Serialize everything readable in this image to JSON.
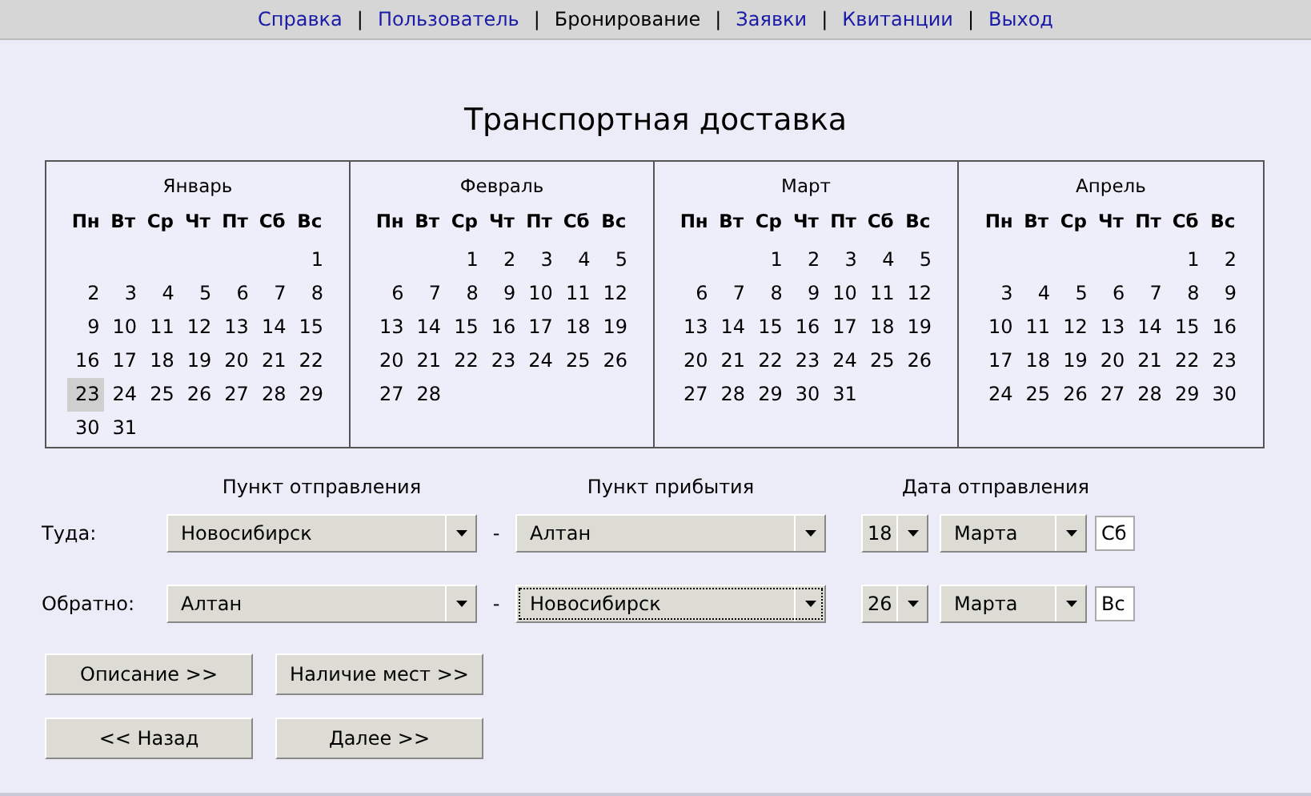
{
  "nav": {
    "items": [
      {
        "label": "Справка",
        "selected": false
      },
      {
        "label": "Пользователь",
        "selected": false
      },
      {
        "label": "Бронирование",
        "selected": true
      },
      {
        "label": "Заявки",
        "selected": false
      },
      {
        "label": "Квитанции",
        "selected": false
      },
      {
        "label": "Выход",
        "selected": false
      }
    ],
    "separators": [
      "|",
      "|",
      "|",
      "|",
      "|"
    ]
  },
  "title": "Транспортная доставка",
  "calendar": [
    {
      "month": "Январь",
      "weekdays": [
        "Пн",
        "Вт",
        "Ср",
        "Чт",
        "Пт",
        "Сб",
        "Вс"
      ],
      "weeks": [
        {
          "days": [
            {
              "day": "1",
              "selected": false
            }
          ]
        },
        {
          "days": [
            {
              "day": "2",
              "selected": false
            },
            {
              "day": "3",
              "selected": false
            },
            {
              "day": "4",
              "selected": false
            },
            {
              "day": "5",
              "selected": false
            },
            {
              "day": "6",
              "selected": false
            },
            {
              "day": "7",
              "selected": false
            },
            {
              "day": "8",
              "selected": false
            }
          ]
        },
        {
          "days": [
            {
              "day": "9",
              "selected": false
            },
            {
              "day": "10",
              "selected": false
            },
            {
              "day": "11",
              "selected": false
            },
            {
              "day": "12",
              "selected": false
            },
            {
              "day": "13",
              "selected": false
            },
            {
              "day": "14",
              "selected": false
            },
            {
              "day": "15",
              "selected": false
            }
          ]
        },
        {
          "days": [
            {
              "day": "16",
              "selected": false
            },
            {
              "day": "17",
              "selected": false
            },
            {
              "day": "18",
              "selected": false
            },
            {
              "day": "19",
              "selected": false
            },
            {
              "day": "20",
              "selected": false
            },
            {
              "day": "21",
              "selected": false
            },
            {
              "day": "22",
              "selected": false
            }
          ]
        },
        {
          "days": [
            {
              "day": "23",
              "selected": true
            },
            {
              "day": "24",
              "selected": false
            },
            {
              "day": "25",
              "selected": false
            },
            {
              "day": "26",
              "selected": false
            },
            {
              "day": "27",
              "selected": false
            },
            {
              "day": "28",
              "selected": false
            },
            {
              "day": "29",
              "selected": false
            }
          ]
        },
        {
          "days": [
            {
              "day": "30",
              "selected": false
            },
            {
              "day": "31",
              "selected": false
            }
          ]
        }
      ]
    },
    {
      "month": "Февраль",
      "weekdays": [
        "Пн",
        "Вт",
        "Ср",
        "Чт",
        "Пт",
        "Сб",
        "Вс"
      ],
      "weeks": [
        {
          "days": [
            {
              "day": "1",
              "selected": false
            },
            {
              "day": "2",
              "selected": false
            },
            {
              "day": "3",
              "selected": false
            },
            {
              "day": "4",
              "selected": false
            },
            {
              "day": "5",
              "selected": false
            }
          ]
        },
        {
          "days": [
            {
              "day": "6",
              "selected": false
            },
            {
              "day": "7",
              "selected": false
            },
            {
              "day": "8",
              "selected": false
            },
            {
              "day": "9",
              "selected": false
            },
            {
              "day": "10",
              "selected": false
            },
            {
              "day": "11",
              "selected": false
            },
            {
              "day": "12",
              "selected": false
            }
          ]
        },
        {
          "days": [
            {
              "day": "13",
              "selected": false
            },
            {
              "day": "14",
              "selected": false
            },
            {
              "day": "15",
              "selected": false
            },
            {
              "day": "16",
              "selected": false
            },
            {
              "day": "17",
              "selected": false
            },
            {
              "day": "18",
              "selected": false
            },
            {
              "day": "19",
              "selected": false
            }
          ]
        },
        {
          "days": [
            {
              "day": "20",
              "selected": false
            },
            {
              "day": "21",
              "selected": false
            },
            {
              "day": "22",
              "selected": false
            },
            {
              "day": "23",
              "selected": false
            },
            {
              "day": "24",
              "selected": false
            },
            {
              "day": "25",
              "selected": false
            },
            {
              "day": "26",
              "selected": false
            }
          ]
        },
        {
          "days": [
            {
              "day": "27",
              "selected": false
            },
            {
              "day": "28",
              "selected": false
            }
          ]
        }
      ]
    },
    {
      "month": "Март",
      "weekdays": [
        "Пн",
        "Вт",
        "Ср",
        "Чт",
        "Пт",
        "Сб",
        "Вс"
      ],
      "weeks": [
        {
          "days": [
            {
              "day": "1",
              "selected": false
            },
            {
              "day": "2",
              "selected": false
            },
            {
              "day": "3",
              "selected": false
            },
            {
              "day": "4",
              "selected": false
            },
            {
              "day": "5",
              "selected": false
            }
          ]
        },
        {
          "days": [
            {
              "day": "6",
              "selected": false
            },
            {
              "day": "7",
              "selected": false
            },
            {
              "day": "8",
              "selected": false
            },
            {
              "day": "9",
              "selected": false
            },
            {
              "day": "10",
              "selected": false
            },
            {
              "day": "11",
              "selected": false
            },
            {
              "day": "12",
              "selected": false
            }
          ]
        },
        {
          "days": [
            {
              "day": "13",
              "selected": false
            },
            {
              "day": "14",
              "selected": false
            },
            {
              "day": "15",
              "selected": false
            },
            {
              "day": "16",
              "selected": false
            },
            {
              "day": "17",
              "selected": false
            },
            {
              "day": "18",
              "selected": false
            },
            {
              "day": "19",
              "selected": false
            }
          ]
        },
        {
          "days": [
            {
              "day": "20",
              "selected": false
            },
            {
              "day": "21",
              "selected": false
            },
            {
              "day": "22",
              "selected": false
            },
            {
              "day": "23",
              "selected": false
            },
            {
              "day": "24",
              "selected": false
            },
            {
              "day": "25",
              "selected": false
            },
            {
              "day": "26",
              "selected": false
            }
          ]
        },
        {
          "days": [
            {
              "day": "27",
              "selected": false
            },
            {
              "day": "28",
              "selected": false
            },
            {
              "day": "29",
              "selected": false
            },
            {
              "day": "30",
              "selected": false
            },
            {
              "day": "31",
              "selected": false
            }
          ]
        }
      ]
    },
    {
      "month": "Апрель",
      "weekdays": [
        "Пн",
        "Вт",
        "Ср",
        "Чт",
        "Пт",
        "Сб",
        "Вс"
      ],
      "weeks": [
        {
          "days": [
            {
              "day": "1",
              "selected": false
            },
            {
              "day": "2",
              "selected": false
            }
          ]
        },
        {
          "days": [
            {
              "day": "3",
              "selected": false
            },
            {
              "day": "4",
              "selected": false
            },
            {
              "day": "5",
              "selected": false
            },
            {
              "day": "6",
              "selected": false
            },
            {
              "day": "7",
              "selected": false
            },
            {
              "day": "8",
              "selected": false
            },
            {
              "day": "9",
              "selected": false
            }
          ]
        },
        {
          "days": [
            {
              "day": "10",
              "selected": false
            },
            {
              "day": "11",
              "selected": false
            },
            {
              "day": "12",
              "selected": false
            },
            {
              "day": "13",
              "selected": false
            },
            {
              "day": "14",
              "selected": false
            },
            {
              "day": "15",
              "selected": false
            },
            {
              "day": "16",
              "selected": false
            }
          ]
        },
        {
          "days": [
            {
              "day": "17",
              "selected": false
            },
            {
              "day": "18",
              "selected": false
            },
            {
              "day": "19",
              "selected": false
            },
            {
              "day": "20",
              "selected": false
            },
            {
              "day": "21",
              "selected": false
            },
            {
              "day": "22",
              "selected": false
            },
            {
              "day": "23",
              "selected": false
            }
          ]
        },
        {
          "days": [
            {
              "day": "24",
              "selected": false
            },
            {
              "day": "25",
              "selected": false
            },
            {
              "day": "26",
              "selected": false
            },
            {
              "day": "27",
              "selected": false
            },
            {
              "day": "28",
              "selected": false
            },
            {
              "day": "29",
              "selected": false
            },
            {
              "day": "30",
              "selected": false
            }
          ]
        }
      ]
    }
  ],
  "route": {
    "headers": [
      "Пункт отправления",
      "Пункт прибытия",
      "Дата отправления"
    ],
    "rows": [
      {
        "label": "Туда:",
        "from": {
          "value": "Новосибирск",
          "focused": false
        },
        "dash": "-",
        "to": {
          "value": "Алтан",
          "focused": false
        },
        "day": "18",
        "month": "Марта",
        "weekday": "Сб"
      },
      {
        "label": "Обратно:",
        "from": {
          "value": "Алтан",
          "focused": false
        },
        "dash": "-",
        "to": {
          "value": "Новосибирск",
          "focused": true
        },
        "day": "26",
        "month": "Марта",
        "weekday": "Вс"
      }
    ]
  },
  "buttons": [
    [
      "Описание >>",
      "Наличие мест >>"
    ],
    [
      "<< Назад",
      "Далее >>"
    ]
  ]
}
